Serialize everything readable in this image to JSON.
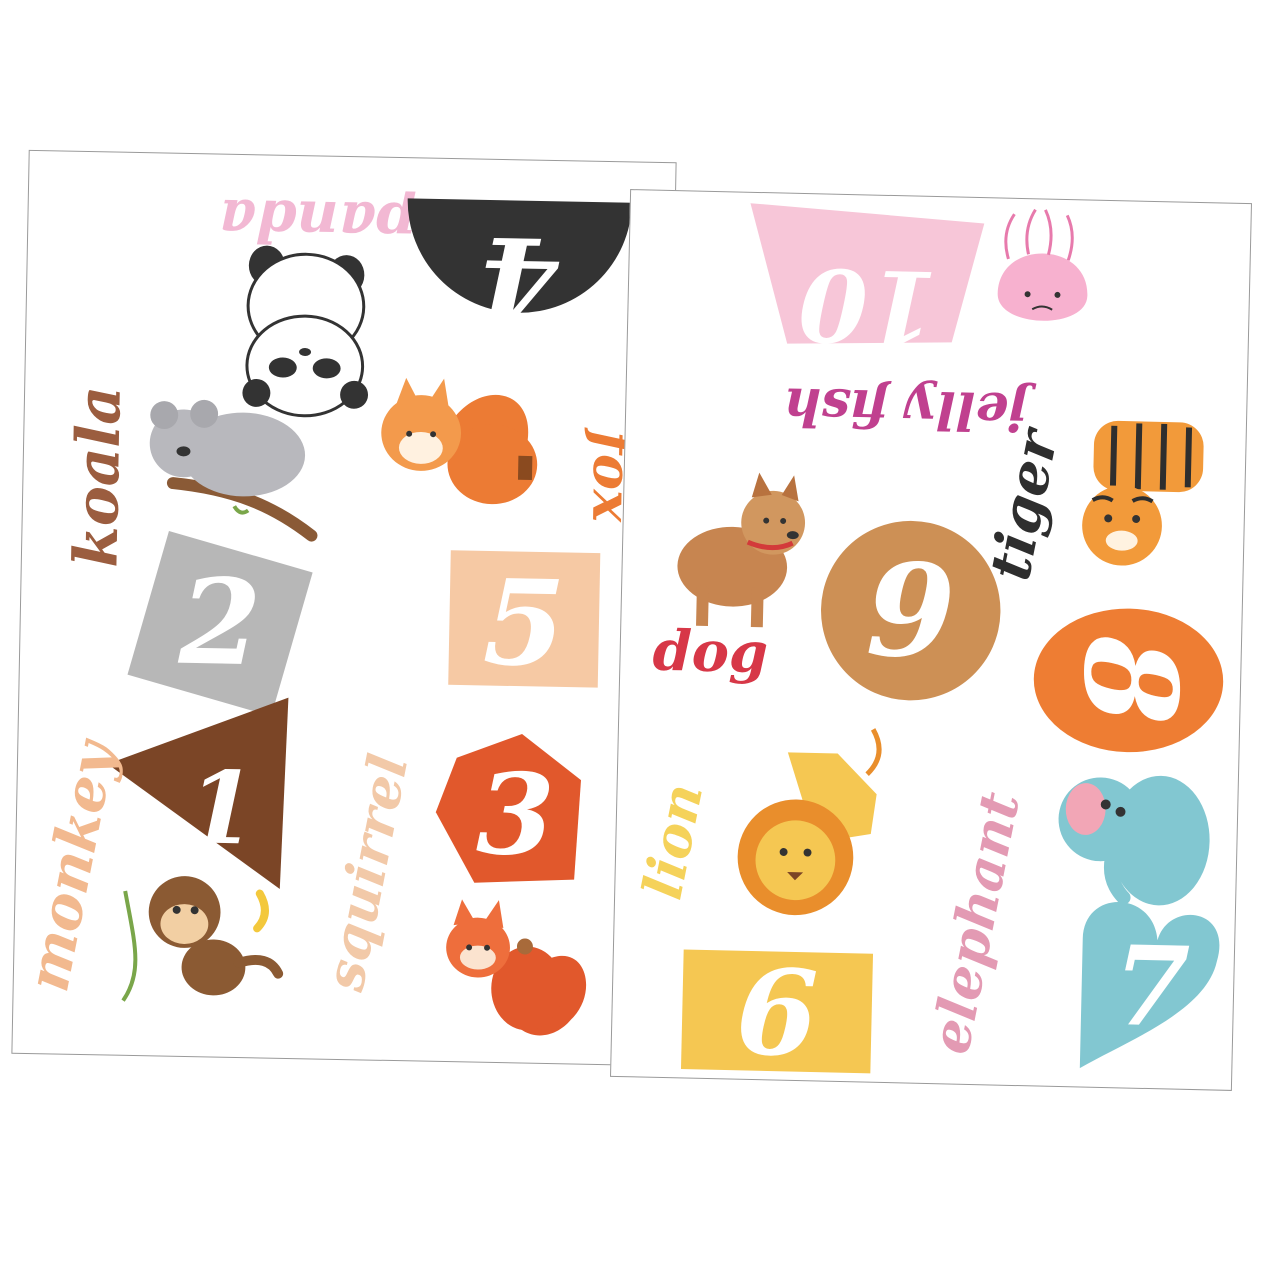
{
  "sheets": [
    {
      "numbers": [
        "4",
        "2",
        "5",
        "1",
        "3"
      ],
      "words": [
        "panda",
        "koala",
        "fox",
        "monkey",
        "squirrel"
      ]
    },
    {
      "numbers": [
        "10",
        "6",
        "8",
        "9",
        "7"
      ],
      "words": [
        "jelly fish",
        "tiger",
        "dog",
        "lion",
        "elephant"
      ]
    }
  ],
  "colors": {
    "panda_shape": "#333333",
    "koala_shape": "#b7b7b7",
    "fox_shape": "#f6c9a4",
    "monkey_shape": "#7b4526",
    "squirrel_shape": "#e1582c",
    "jellyfish_shape": "#f7c6d8",
    "dog_shape": "#cd9055",
    "tiger_shape": "#ee7d33",
    "lion_shape": "#f5c752",
    "elephant_shape": "#82c7d1"
  },
  "icons": [
    "panda-icon",
    "koala-icon",
    "fox-icon",
    "monkey-icon",
    "squirrel-icon",
    "jellyfish-icon",
    "tiger-icon",
    "dog-icon",
    "lion-icon",
    "elephant-icon"
  ]
}
